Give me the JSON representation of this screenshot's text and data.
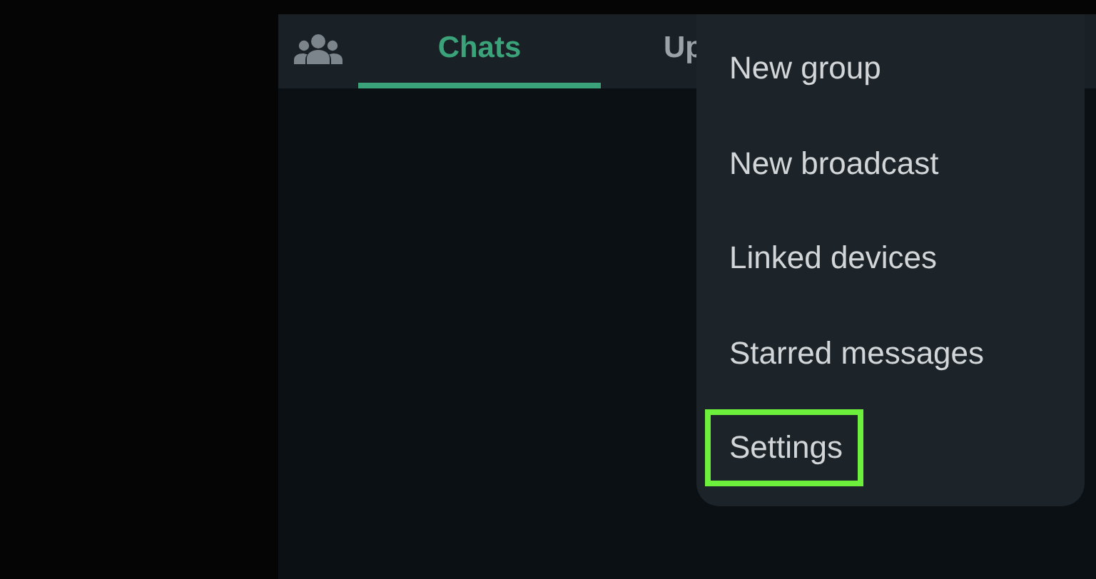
{
  "tabs": [
    {
      "kind": "icon",
      "selected": false
    },
    {
      "kind": "text",
      "label": "Chats",
      "selected": true
    },
    {
      "kind": "text",
      "label": "Up",
      "selected": false
    }
  ],
  "menu": {
    "items": [
      {
        "label": "New group",
        "highlighted": false
      },
      {
        "label": "New broadcast",
        "highlighted": false
      },
      {
        "label": "Linked devices",
        "highlighted": false
      },
      {
        "label": "Starred messages",
        "highlighted": false
      },
      {
        "label": "Settings",
        "highlighted": true
      }
    ]
  }
}
